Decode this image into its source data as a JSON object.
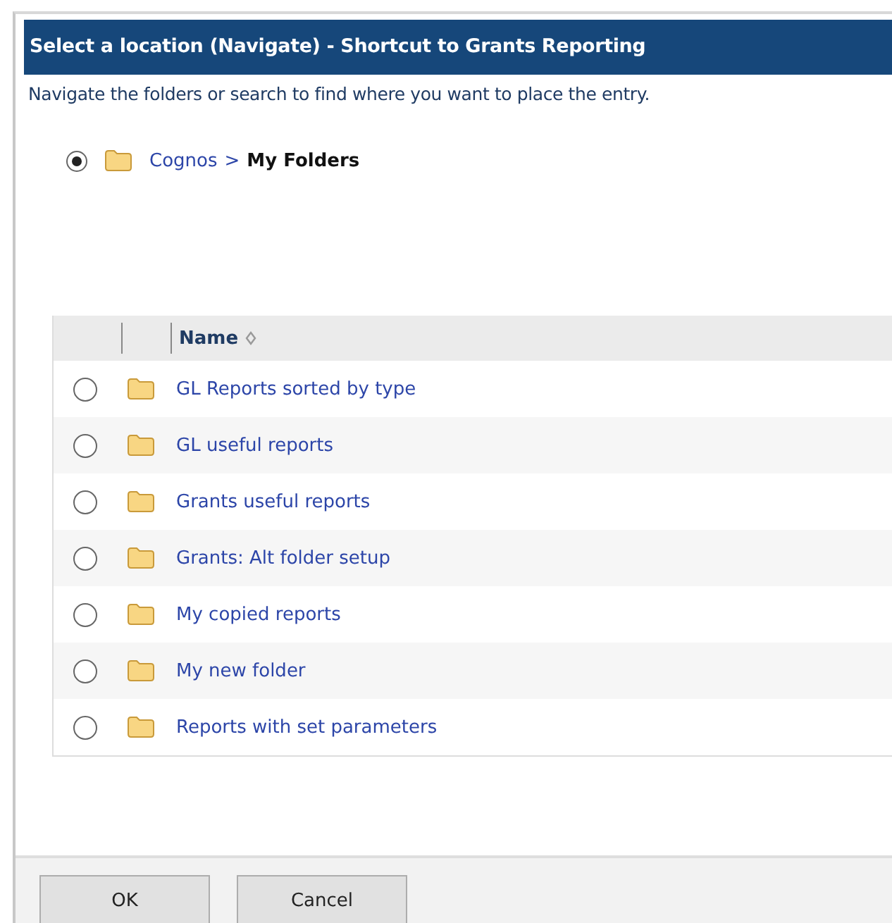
{
  "title": "Select a location (Navigate) - Shortcut to Grants Reporting",
  "instructions": "Navigate the folders or search to find where you want to place the entry.",
  "breadcrumb": {
    "selected": true,
    "parent": "Cognos",
    "separator": ">",
    "current": "My Folders"
  },
  "table": {
    "columns": [
      {
        "label": "Name"
      }
    ],
    "rows": [
      {
        "name": "GL Reports sorted by type",
        "selected": false
      },
      {
        "name": "GL useful reports",
        "selected": false
      },
      {
        "name": "Grants useful reports",
        "selected": false
      },
      {
        "name": "Grants: Alt folder setup",
        "selected": false
      },
      {
        "name": "My copied reports",
        "selected": false
      },
      {
        "name": "My new folder",
        "selected": false
      },
      {
        "name": "Reports with set parameters",
        "selected": false
      }
    ]
  },
  "buttons": [
    "OK",
    "Cancel"
  ]
}
